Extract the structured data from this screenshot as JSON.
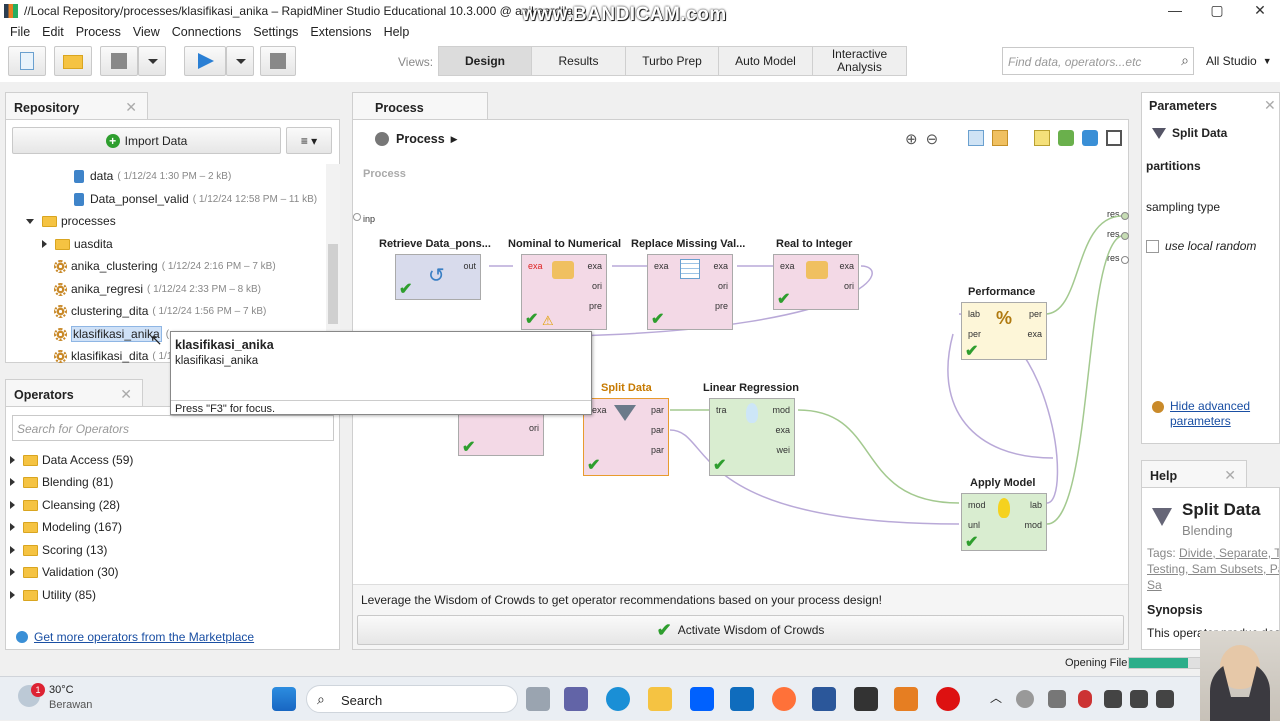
{
  "window": {
    "title": "//Local Repository/processes/klasifikasi_anika – RapidMiner Studio Educational 10.3.000 @ anikaardila",
    "watermark": "www.BANDICAM.com"
  },
  "menu": [
    "File",
    "Edit",
    "Process",
    "View",
    "Connections",
    "Settings",
    "Extensions",
    "Help"
  ],
  "toolbar": {
    "views_label": "Views:",
    "views": [
      "Design",
      "Results",
      "Turbo Prep",
      "Auto Model",
      "Interactive Analysis"
    ],
    "search_placeholder": "Find data, operators...etc",
    "studio_select": "All Studio"
  },
  "repository": {
    "tab": "Repository",
    "import_label": "Import Data",
    "items": [
      {
        "label": "data",
        "meta": "( 1/12/24 1:30 PM – 2 kB)"
      },
      {
        "label": "Data_ponsel_valid",
        "meta": "( 1/12/24 12:58 PM – 11 kB)"
      },
      {
        "label": "processes",
        "meta": ""
      },
      {
        "label": "uasdita",
        "meta": ""
      },
      {
        "label": "anika_clustering",
        "meta": "( 1/12/24 2:16 PM – 7 kB)"
      },
      {
        "label": "anika_regresi",
        "meta": "( 1/12/24 2:33 PM – 8 kB)"
      },
      {
        "label": "clustering_dita",
        "meta": "( 1/12/24 1:56 PM – 7 kB)"
      },
      {
        "label": "klasifikasi_anika",
        "meta": "("
      },
      {
        "label": "klasifikasi_dita",
        "meta": "( 1/1"
      }
    ]
  },
  "tooltip": {
    "title": "klasifikasi_anika",
    "subtitle": "klasifikasi_anika",
    "footer": "Press \"F3\" for focus."
  },
  "operators_panel": {
    "tab": "Operators",
    "search_placeholder": "Search for Operators",
    "groups": [
      "Data Access (59)",
      "Blending (81)",
      "Cleansing (28)",
      "Modeling (167)",
      "Scoring (13)",
      "Validation (30)",
      "Utility (85)"
    ],
    "marketplace_link": "Get more operators from the Marketplace"
  },
  "process": {
    "tab": "Process",
    "breadcrumb": "Process",
    "canvas_label": "Process",
    "inp": "inp",
    "res": [
      "res",
      "res",
      "res"
    ],
    "operators": {
      "retrieve": "Retrieve Data_pons...",
      "nominal": "Nominal to Numerical",
      "replace": "Replace Missing Val...",
      "real": "Real to Integer",
      "performance": "Performance",
      "split": "Split Data",
      "linreg": "Linear Regression",
      "apply": "Apply Model"
    },
    "ports": {
      "out": "out",
      "exa": "exa",
      "ori": "ori",
      "pre": "pre",
      "lab": "lab",
      "per": "per",
      "par": "par",
      "tra": "tra",
      "mod": "mod",
      "wei": "wei",
      "unl": "unl"
    },
    "wisdom_text": "Leverage the Wisdom of Crowds to get operator recommendations based on your process design!",
    "wisdom_button": "Activate Wisdom of Crowds"
  },
  "parameters": {
    "tab": "Parameters",
    "operator": "Split Data",
    "rows": [
      "partitions",
      "sampling type"
    ],
    "checkbox": "use local random",
    "advanced_link": "Hide advanced parameters"
  },
  "help": {
    "tab": "Help",
    "title": "Split Data",
    "group": "Blending",
    "tags_label": "Tags:",
    "tags": "Divide, Separate, Training, Testing, Sam Subsets, Partitions, Sa",
    "synopsis": "Synopsis",
    "synopsis_text": "This operator produc desired number of s"
  },
  "status": {
    "text": "Opening File",
    "progress": 0.6
  },
  "taskbar": {
    "temp": "30°C",
    "weather": "Berawan",
    "search": "Search",
    "badge": "1"
  }
}
